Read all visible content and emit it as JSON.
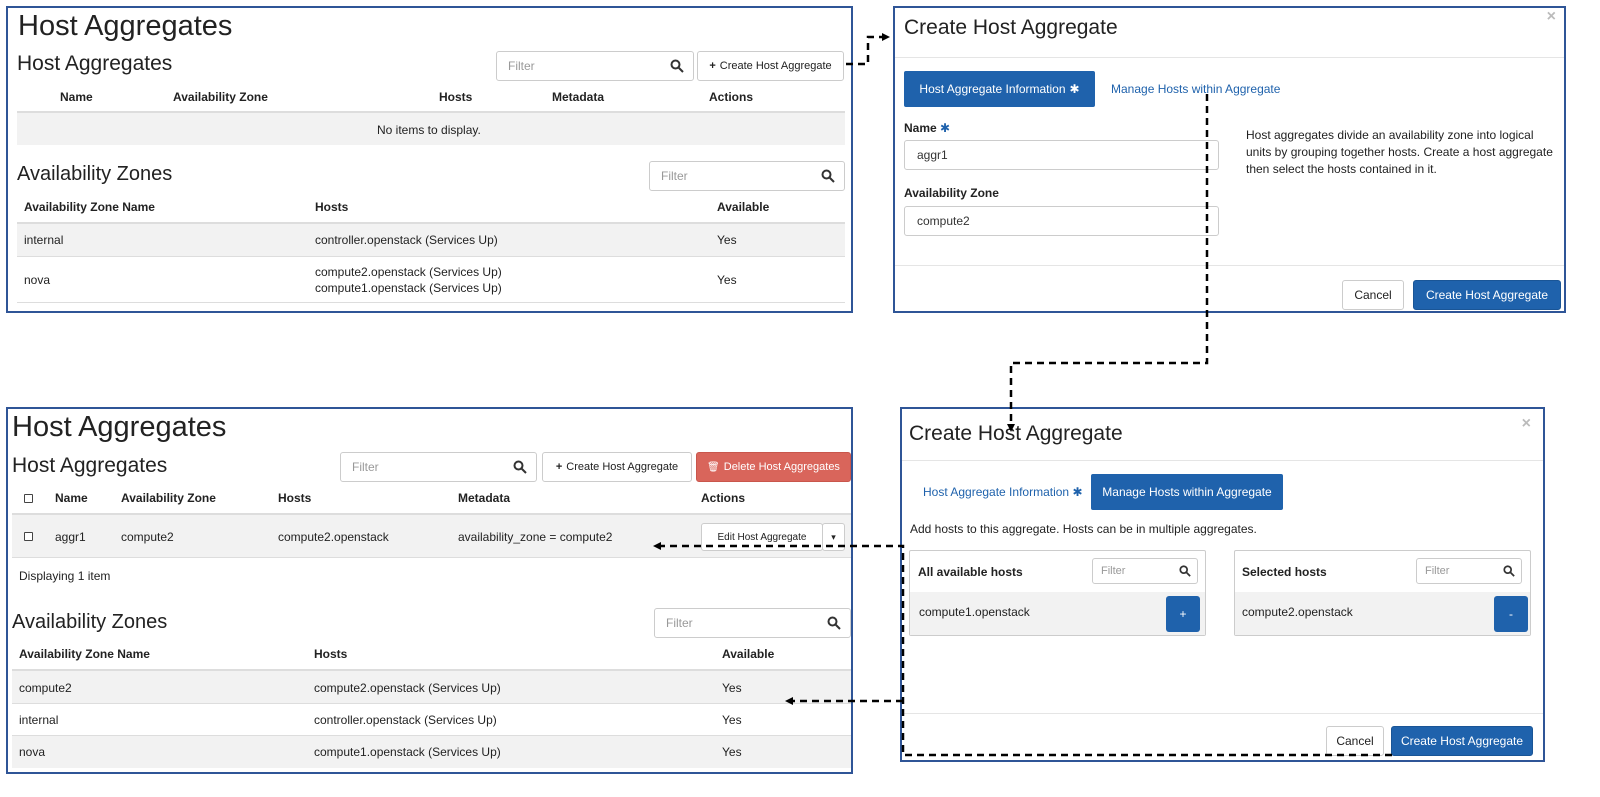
{
  "top_left": {
    "title": "Host Aggregates",
    "section_title": "Host Aggregates",
    "filter_placeholder": "Filter",
    "create_button": "Create Host Aggregate",
    "columns": [
      "Name",
      "Availability Zone",
      "Hosts",
      "Metadata",
      "Actions"
    ],
    "empty_message": "No items to display.",
    "az_title": "Availability Zones",
    "az_filter_placeholder": "Filter",
    "az_columns": [
      "Availability Zone Name",
      "Hosts",
      "Available"
    ],
    "az_rows": [
      {
        "name": "internal",
        "hosts": [
          "controller.openstack (Services Up)"
        ],
        "available": "Yes"
      },
      {
        "name": "nova",
        "hosts": [
          "compute2.openstack (Services Up)",
          "compute1.openstack (Services Up)"
        ],
        "available": "Yes"
      }
    ]
  },
  "top_right": {
    "title": "Create Host Aggregate",
    "tab_info": "Host Aggregate Information",
    "tab_manage": "Manage Hosts within Aggregate",
    "name_label": "Name",
    "name_value": "aggr1",
    "az_label": "Availability Zone",
    "az_value": "compute2",
    "help_text": [
      "Host aggregates divide an availability zone into logical",
      "units by grouping together hosts. Create a host aggregate",
      "then select the hosts contained in it."
    ],
    "cancel": "Cancel",
    "submit": "Create Host Aggregate"
  },
  "bottom_left": {
    "title": "Host Aggregates",
    "section_title": "Host Aggregates",
    "filter_placeholder": "Filter",
    "create_button": "Create Host Aggregate",
    "delete_button": "Delete Host Aggregates",
    "columns": [
      "Name",
      "Availability Zone",
      "Hosts",
      "Metadata",
      "Actions"
    ],
    "rows": [
      {
        "name": "aggr1",
        "az": "compute2",
        "hosts": "compute2.openstack",
        "metadata": "availability_zone = compute2",
        "action": "Edit Host Aggregate"
      }
    ],
    "footer": "Displaying 1 item",
    "az_title": "Availability Zones",
    "az_filter_placeholder": "Filter",
    "az_columns": [
      "Availability Zone Name",
      "Hosts",
      "Available"
    ],
    "az_rows": [
      {
        "name": "compute2",
        "hosts": "compute2.openstack (Services Up)",
        "available": "Yes"
      },
      {
        "name": "internal",
        "hosts": "controller.openstack (Services Up)",
        "available": "Yes"
      },
      {
        "name": "nova",
        "hosts": "compute1.openstack (Services Up)",
        "available": "Yes"
      }
    ]
  },
  "bottom_right": {
    "title": "Create Host Aggregate",
    "tab_info": "Host Aggregate Information",
    "tab_manage": "Manage Hosts within Aggregate",
    "intro": "Add hosts to this aggregate. Hosts can be in multiple aggregates.",
    "available_title": "All available hosts",
    "available_filter": "Filter",
    "available_hosts": [
      "compute1.openstack"
    ],
    "add_symbol": "+",
    "selected_title": "Selected hosts",
    "selected_filter": "Filter",
    "selected_hosts": [
      "compute2.openstack"
    ],
    "remove_symbol": "-",
    "cancel": "Cancel",
    "submit": "Create Host Aggregate"
  },
  "colors": {
    "panel_border": "#2f5597",
    "primary": "#1f62ac",
    "danger": "#d9655b",
    "row_alt": "#f2f2f2"
  },
  "icons": [
    "plus-icon",
    "search-icon",
    "trash-icon",
    "close-icon",
    "required-asterisk-icon",
    "caret-down-icon"
  ]
}
